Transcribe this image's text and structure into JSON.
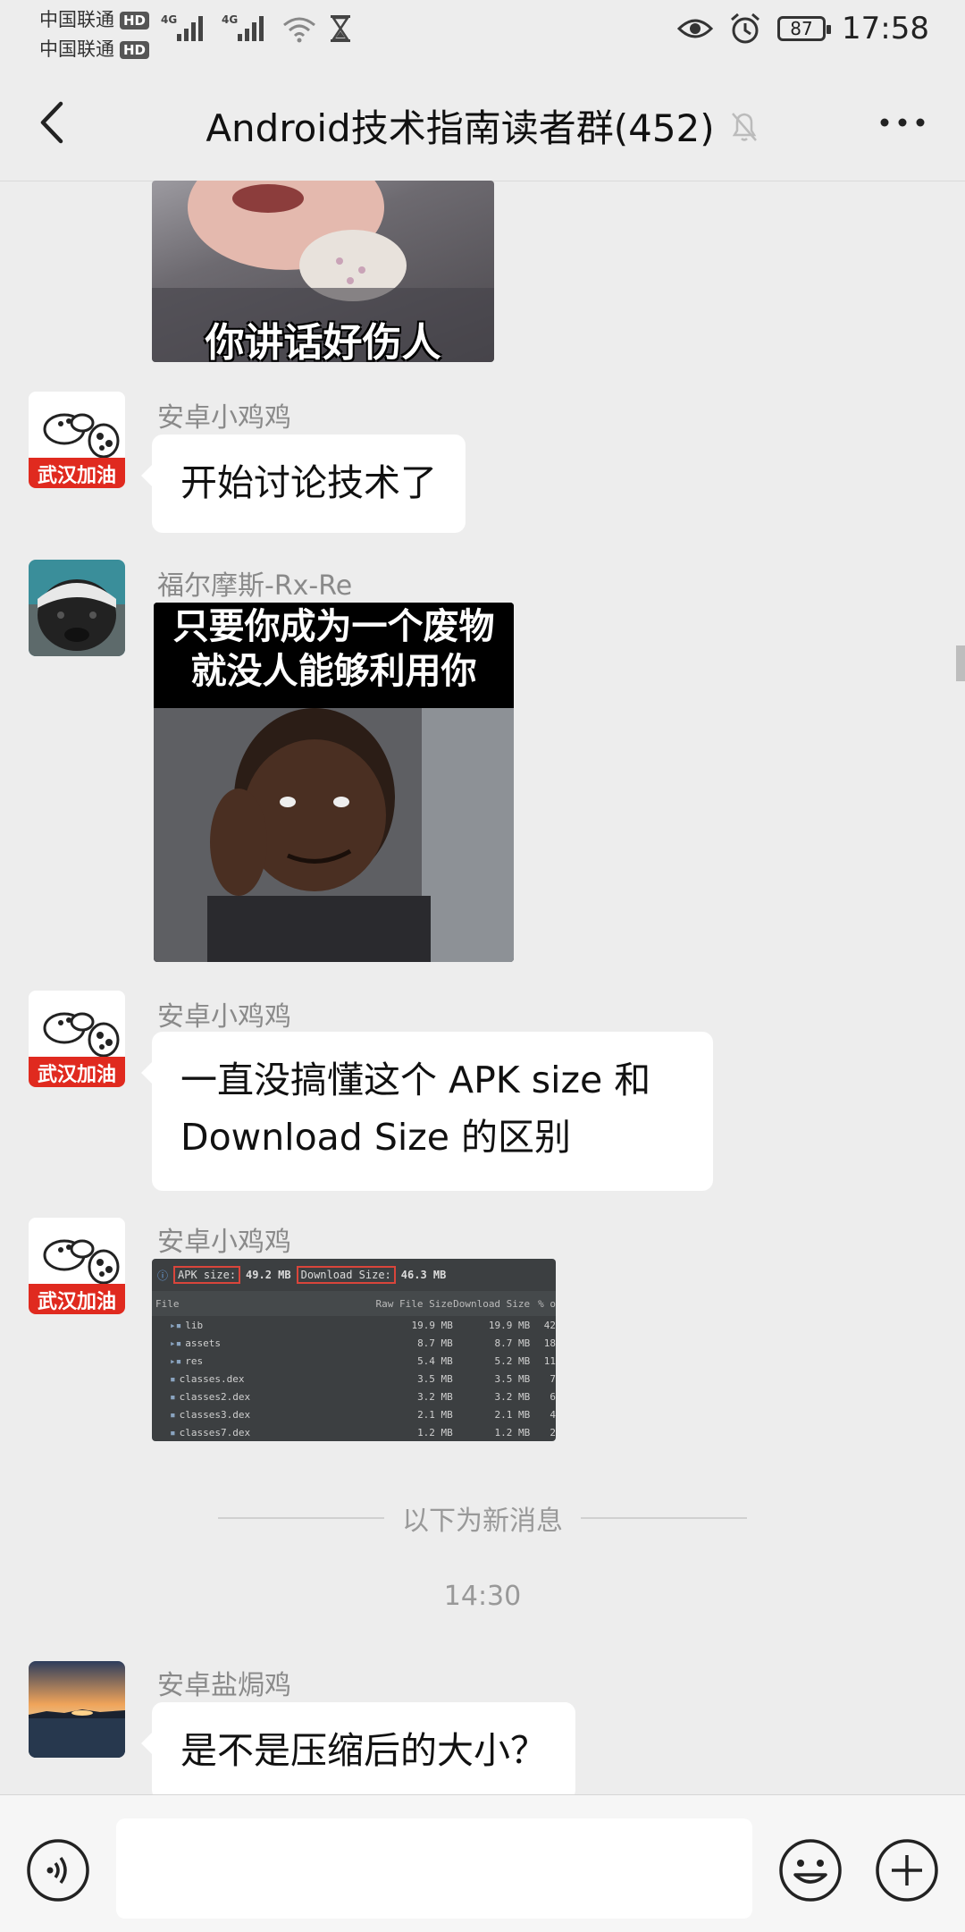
{
  "status_bar": {
    "carrier1": "中国联通",
    "carrier2": "中国联通",
    "hd_badge": "HD",
    "net1": "4G",
    "net2": "4G",
    "battery": "87",
    "time": "17:58"
  },
  "header": {
    "title": "Android技术指南读者群(452)"
  },
  "messages": [
    {
      "caption": "你讲话好伤人"
    },
    {
      "sender": "安卓小鸡鸡",
      "text": "开始讨论技术了",
      "avatar_text": "武汉加油"
    },
    {
      "sender": "福尔摩斯-Rx-Re",
      "caption_line1": "只要你成为一个废物",
      "caption_line2": "就没人能够利用你"
    },
    {
      "sender": "安卓小鸡鸡",
      "text_line1": "一直没搞懂这个 APK size 和",
      "text_line2": "Download Size 的区别",
      "avatar_text": "武汉加油"
    },
    {
      "sender": "安卓小鸡鸡",
      "avatar_text": "武汉加油",
      "screenshot": {
        "apk_label": "APK size:",
        "apk_value": "49.2 MB",
        "dl_label": "Download Size:",
        "dl_value": "46.3 MB",
        "col_file": "File",
        "col_raw": "Raw File Size",
        "col_dl": "Download Size",
        "col_pct": "% o",
        "rows": [
          {
            "name": "lib",
            "raw": "19.9 MB",
            "dl": "19.9 MB",
            "pct": "42"
          },
          {
            "name": "assets",
            "raw": "8.7 MB",
            "dl": "8.7 MB",
            "pct": "18"
          },
          {
            "name": "res",
            "raw": "5.4 MB",
            "dl": "5.2 MB",
            "pct": "11"
          },
          {
            "name": "classes.dex",
            "raw": "3.5 MB",
            "dl": "3.5 MB",
            "pct": "7"
          },
          {
            "name": "classes2.dex",
            "raw": "3.2 MB",
            "dl": "3.2 MB",
            "pct": "6"
          },
          {
            "name": "classes3.dex",
            "raw": "2.1 MB",
            "dl": "2.1 MB",
            "pct": "4"
          },
          {
            "name": "classes7.dex",
            "raw": "1.2 MB",
            "dl": "1.2 MB",
            "pct": "2"
          }
        ]
      }
    }
  ],
  "new_messages_divider": "以下为新消息",
  "timestamp": "14:30",
  "last_message": {
    "sender": "安卓盐焗鸡",
    "text": "是不是压缩后的大小？"
  },
  "input": {
    "placeholder": ""
  }
}
